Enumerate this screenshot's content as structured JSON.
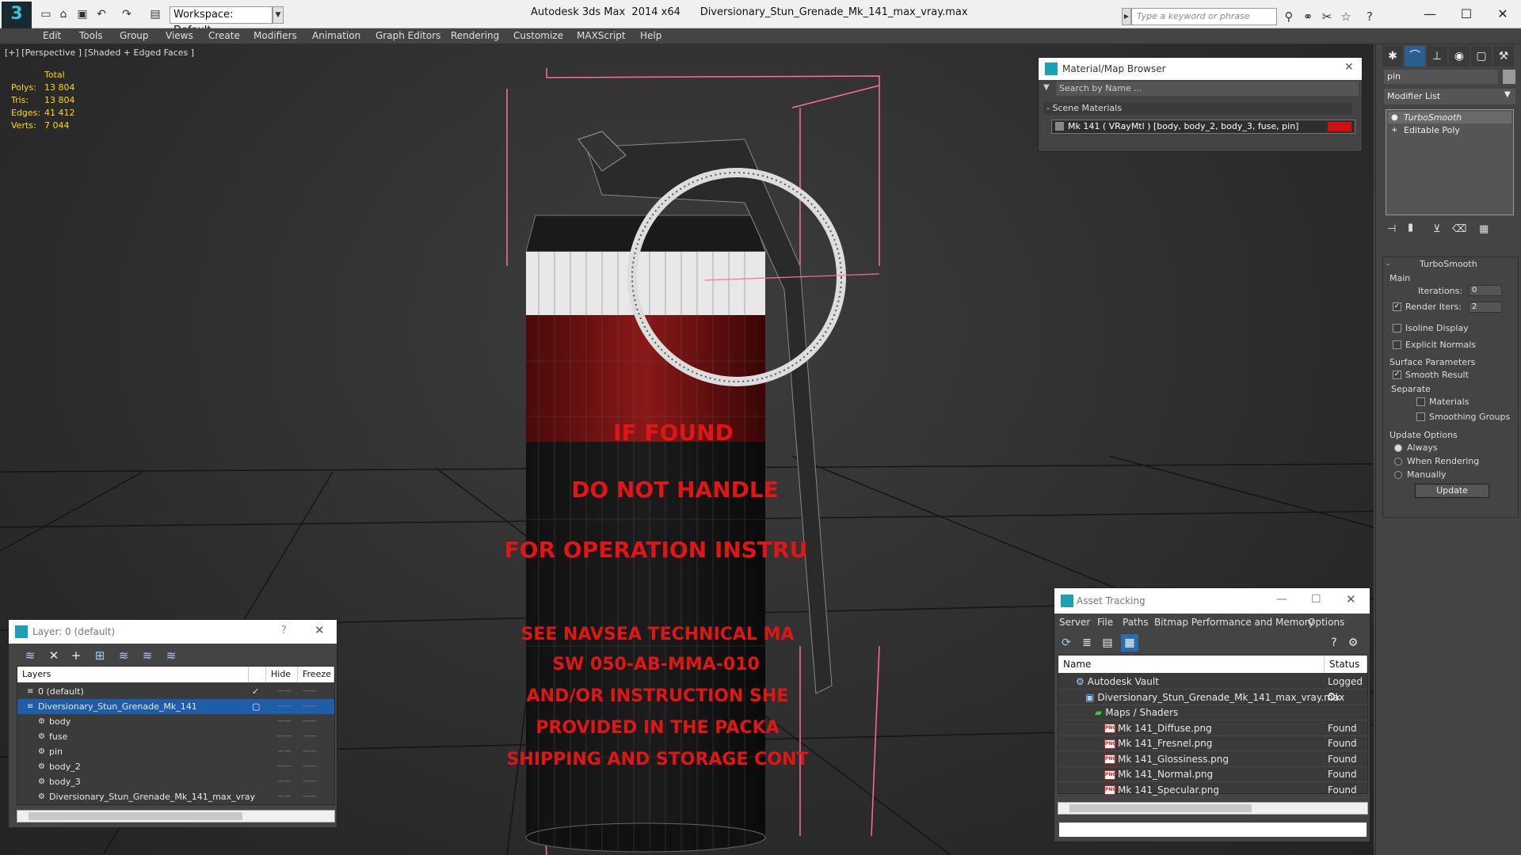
{
  "titlebar": {
    "app": "Autodesk 3ds Max  2014 x64",
    "file": "Diversionary_Stun_Grenade_Mk_141_max_vray.max",
    "workspace": "Workspace: Default",
    "search_placeholder": "Type a keyword or phrase"
  },
  "menu": [
    "Edit",
    "Tools",
    "Group",
    "Views",
    "Create",
    "Modifiers",
    "Animation",
    "Graph Editors",
    "Rendering",
    "Customize",
    "MAXScript",
    "Help"
  ],
  "viewport": {
    "label": "[+] [Perspective ] [Shaded + Edged Faces ]",
    "stats": {
      "header": "Total",
      "rows": [
        {
          "label": "Polys:",
          "value": "13 804"
        },
        {
          "label": "Tris:",
          "value": "13 804"
        },
        {
          "label": "Edges:",
          "value": "41 412"
        },
        {
          "label": "Verts:",
          "value": "7 044"
        }
      ]
    },
    "decal_lines": [
      "IF FOUND",
      "DO NOT HANDLE",
      "FOR OPERATION INSTRU",
      "SEE NAVSEA TECHNICAL MA",
      "SW 050-AB-MMA-010",
      "AND/OR INSTRUCTION SHE",
      "PROVIDED IN THE PACKA",
      "SHIPPING AND STORAGE CONT"
    ]
  },
  "material_browser": {
    "title": "Material/Map Browser",
    "search": "Search by Name ...",
    "section": "Scene Materials",
    "item": "Mk 141  ( VRayMtl )  [body, body_2, body_3, fuse, pin]",
    "swatch_color": "#d01010"
  },
  "command_panel": {
    "object_name": "pin",
    "modifier_list": "Modifier List",
    "stack": [
      "TurboSmooth",
      "Editable Poly"
    ],
    "rollout_title": "TurboSmooth",
    "main_label": "Main",
    "iterations_label": "Iterations:",
    "iterations_value": "0",
    "render_iters_label": "Render Iters:",
    "render_iters_value": "2",
    "isoline": "Isoline Display",
    "explicit_normals": "Explicit Normals",
    "surface_params": "Surface Parameters",
    "smooth_result": "Smooth Result",
    "separate": "Separate",
    "materials": "Materials",
    "smoothing_groups": "Smoothing Groups",
    "update_options": "Update Options",
    "always": "Always",
    "when_rendering": "When Rendering",
    "manually": "Manually",
    "update_button": "Update"
  },
  "layer_window": {
    "title": "Layer: 0 (default)",
    "help": "?",
    "headers": {
      "layers": "Layers",
      "hide": "Hide",
      "freeze": "Freeze"
    },
    "rows": [
      {
        "name": "0 (default)",
        "indent": 1
      },
      {
        "name": "Diversionary_Stun_Grenade_Mk_141",
        "indent": 1
      },
      {
        "name": "body",
        "indent": 2
      },
      {
        "name": "fuse",
        "indent": 2
      },
      {
        "name": "pin",
        "indent": 2
      },
      {
        "name": "body_2",
        "indent": 2
      },
      {
        "name": "body_3",
        "indent": 2
      },
      {
        "name": "Diversionary_Stun_Grenade_Mk_141_max_vray",
        "indent": 2
      }
    ]
  },
  "asset_tracking": {
    "title": "Asset Tracking",
    "menu": [
      "Server",
      "File",
      "Paths",
      "Bitmap Performance and Memory",
      "Options"
    ],
    "headers": {
      "name": "Name",
      "status": "Status"
    },
    "rows": [
      {
        "name": "Autodesk Vault",
        "status": "Logged O",
        "indent": 1
      },
      {
        "name": "Diversionary_Stun_Grenade_Mk_141_max_vray.max",
        "status": "Ok",
        "indent": 2
      },
      {
        "name": "Maps / Shaders",
        "status": "",
        "indent": 3
      },
      {
        "name": "Mk 141_Diffuse.png",
        "status": "Found",
        "indent": 4
      },
      {
        "name": "Mk 141_Fresnel.png",
        "status": "Found",
        "indent": 4
      },
      {
        "name": "Mk 141_Glossiness.png",
        "status": "Found",
        "indent": 4
      },
      {
        "name": "Mk 141_Normal.png",
        "status": "Found",
        "indent": 4
      },
      {
        "name": "Mk 141_Specular.png",
        "status": "Found",
        "indent": 4
      }
    ]
  }
}
